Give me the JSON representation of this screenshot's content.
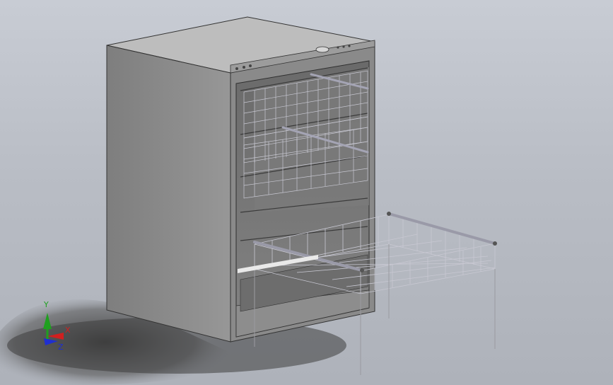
{
  "viewport": {
    "background_top": "#c8ccd4",
    "background_bottom": "#aeb2ba"
  },
  "model": {
    "body_color": "#8c8c8c",
    "top_color": "#bdbdbd",
    "interior_color": "#6f6f6f",
    "wire_color": "#c8c8d2",
    "rod_color": "#9a9aa8"
  },
  "triad": {
    "x_label": "X",
    "y_label": "Y",
    "z_label": "Z",
    "x_color": "#d11f1f",
    "y_color": "#1fa01f",
    "z_color": "#1f2fd1"
  }
}
